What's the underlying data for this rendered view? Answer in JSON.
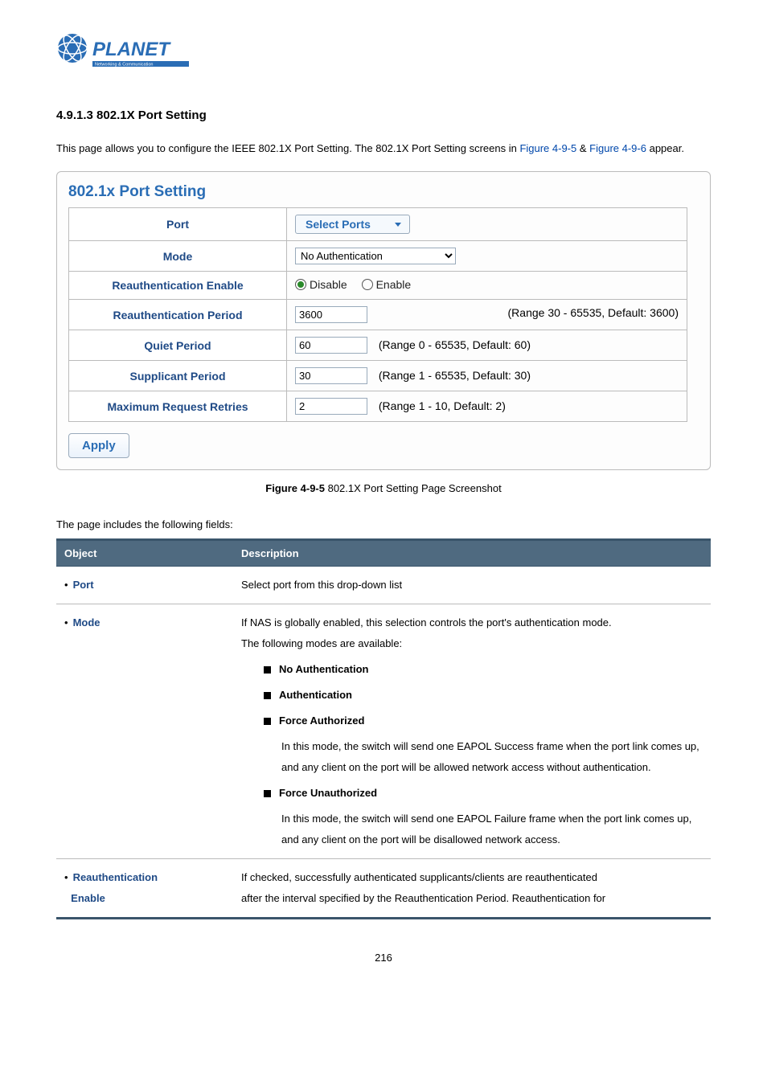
{
  "logo": {
    "brand": "PLANET",
    "tagline": "Networking & Communication"
  },
  "section_title": "4.9.1.3 802.1X Port Setting",
  "intro": {
    "part1": "This page allows you to configure the IEEE 802.1X Port Setting. The 802.1X Port Setting screens in ",
    "link1": "Figure 4-9-5",
    "amp": " & ",
    "link2": "Figure 4-9-6",
    "part2": " appear."
  },
  "panel": {
    "title": "802.1x Port Setting",
    "rows": {
      "port": {
        "label": "Port",
        "button": "Select Ports"
      },
      "mode": {
        "label": "Mode",
        "value": "No Authentication"
      },
      "reauth_enable": {
        "label": "Reauthentication Enable",
        "disable": "Disable",
        "enable": "Enable"
      },
      "reauth_period": {
        "label": "Reauthentication Period",
        "value": "3600",
        "range": "(Range 30 - 65535, Default: 3600)"
      },
      "quiet": {
        "label": "Quiet Period",
        "value": "60",
        "range": "(Range 0 - 65535, Default: 60)"
      },
      "supplicant": {
        "label": "Supplicant Period",
        "value": "30",
        "range": "(Range 1 - 65535, Default: 30)"
      },
      "max_req": {
        "label": "Maximum Request Retries",
        "value": "2",
        "range": "(Range 1 - 10, Default: 2)"
      }
    },
    "apply": "Apply"
  },
  "caption": {
    "bold": "Figure 4-9-5",
    "rest": " 802.1X Port Setting Page Screenshot"
  },
  "fields_intro": "The page includes the following fields:",
  "desc_table": {
    "headers": {
      "object": "Object",
      "description": "Description"
    },
    "port": {
      "name": "Port",
      "desc": "Select port from this drop-down list"
    },
    "mode": {
      "name": "Mode",
      "intro1": "If NAS is globally enabled, this selection controls the port's authentication mode.",
      "intro2": "The following modes are available:",
      "no_auth": "No Authentication",
      "auth": "Authentication",
      "force_auth": "Force Authorized",
      "force_auth_body": "In this mode, the switch will send one EAPOL Success frame when the port link comes up, and any client on the port will be allowed network access without authentication.",
      "force_unauth": "Force Unauthorized",
      "force_unauth_body": "In this mode, the switch will send one EAPOL Failure frame when the port link comes up, and any client on the port will be disallowed network access."
    },
    "reauth": {
      "name": "Reauthentication",
      "name2": "Enable",
      "desc1": "If checked, successfully authenticated supplicants/clients are reauthenticated",
      "desc2": "after the interval specified by the Reauthentication Period. Reauthentication for"
    }
  },
  "page_number": "216"
}
